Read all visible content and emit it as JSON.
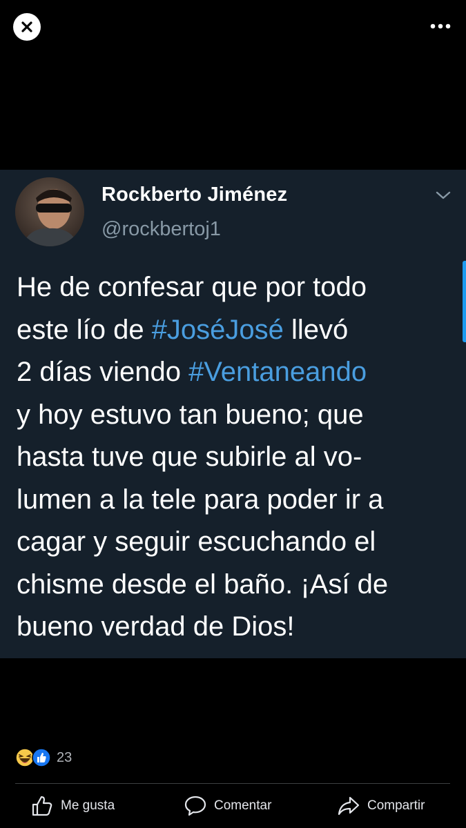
{
  "top_bar": {
    "close_icon": "close-icon",
    "more_icon": "more-horizontal-icon"
  },
  "tweet": {
    "author_name": "Rockberto Jiménez",
    "author_handle": "@rockbertoj1",
    "avatar_icon": "avatar",
    "menu_icon": "chevron-down-icon",
    "lines": [
      [
        {
          "t": "He de confesar que por todo",
          "h": false
        }
      ],
      [
        {
          "t": "este lío de ",
          "h": false
        },
        {
          "t": "#JoséJosé",
          "h": true
        },
        {
          "t": " llevó",
          "h": false
        }
      ],
      [
        {
          "t": "2 días viendo ",
          "h": false
        },
        {
          "t": "#Ventaneando",
          "h": true
        }
      ],
      [
        {
          "t": "y hoy estuvo tan bueno; que",
          "h": false
        }
      ],
      [
        {
          "t": "hasta tuve que subirle al vo-",
          "h": false
        }
      ],
      [
        {
          "t": "lumen a la tele para poder ir a",
          "h": false
        }
      ],
      [
        {
          "t": "cagar y seguir escuchando el",
          "h": false
        }
      ],
      [
        {
          "t": "chisme desde el baño. ¡Así de",
          "h": false
        }
      ],
      [
        {
          "t": "bueno verdad de Dios!",
          "h": false
        }
      ]
    ]
  },
  "reactions": {
    "icons": [
      "haha-reaction-icon",
      "like-reaction-icon"
    ],
    "count": "23"
  },
  "actions": {
    "like_label": "Me gusta",
    "comment_label": "Comentar",
    "share_label": "Compartir"
  },
  "colors": {
    "background": "#000000",
    "card_background": "#15202b",
    "hashtag": "#4a9ee0",
    "handle": "#8899a6",
    "like_blue": "#1877f2"
  }
}
